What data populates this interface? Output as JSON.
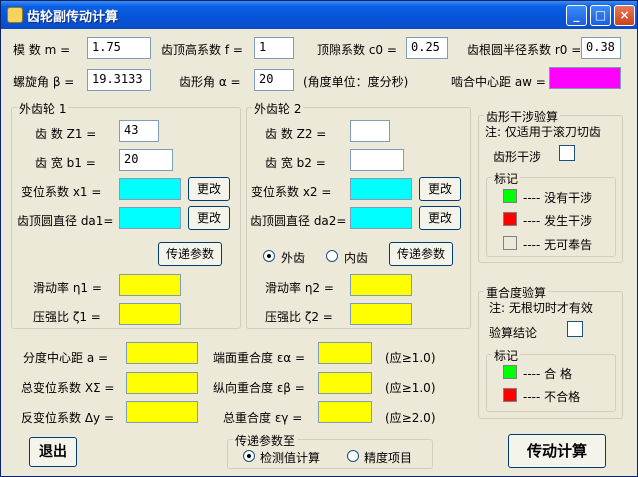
{
  "window": {
    "title": "齿轮副传动计算"
  },
  "params": {
    "module_label": "模  数 m =",
    "module_value": "1.75",
    "addendum_coef_label": "齿顶高系数 f =",
    "addendum_coef_value": "1",
    "clearance_coef_label": "顶隙系数 c0 =",
    "clearance_coef_value": "0.25",
    "root_radius_coef_label": "齿根圆半径系数 r0 =",
    "root_radius_coef_value": "0.38",
    "helix_label": "螺旋角 β =",
    "helix_value": "19.3133",
    "profile_angle_label": "齿形角 α =",
    "profile_angle_value": "20",
    "angle_unit_note": "(角度单位：度分秒)",
    "center_distance_label": "啮合中心距 aw ="
  },
  "gear1": {
    "legend": "外齿轮 1",
    "teeth_label": "齿  数 Z1 =",
    "teeth_value": "43",
    "width_label": "齿  宽 b1 =",
    "width_value": "20",
    "shift_label": "变位系数  x1 =",
    "tip_dia_label": "齿顶圆直径 da1=",
    "change_label": "更改",
    "pass_label": "传递参数",
    "slide_label": "滑动率 η1 =",
    "pressure_label": "压强比 ζ1 ="
  },
  "gear2": {
    "legend": "外齿轮 2",
    "teeth_label": "齿  数  Z2 =",
    "width_label": "齿  宽  b2 =",
    "shift_label": "变位系数  x2 =",
    "tip_dia_label": "齿顶圆直径 da2=",
    "change_label": "更改",
    "external_label": "外齿",
    "internal_label": "内齿",
    "pass_label": "传递参数",
    "slide_label": "滑动率 η2 =",
    "pressure_label": "压强比 ζ2 ="
  },
  "interference": {
    "legend": "齿形干涉验算",
    "note": "注: 仅适用于滚刀切齿",
    "check_label": "齿形干涉",
    "mark_legend": "标记",
    "no_interference": "---- 没有干涉",
    "interference": "---- 发生干涉",
    "no_info": "---- 无可奉告",
    "colors": {
      "ok": "#00ff00",
      "bad": "#ff0000",
      "none": "#ece9d8"
    }
  },
  "overlap": {
    "legend": "重合度验算",
    "note": "注: 无根切时才有效",
    "conclusion_label": "验算结论",
    "mark_legend": "标记",
    "pass": "----  合  格",
    "fail": "---- 不合格"
  },
  "results": {
    "ref_center_label": "分度中心距   a =",
    "total_shift_label": "总变位系数 XΣ =",
    "inverse_shift_label": "反变位系数 Δy =",
    "face_ratio_label": "端面重合度 εα =",
    "face_ratio_req": "(应≥1.0)",
    "axial_ratio_label": "纵向重合度 εβ =",
    "axial_ratio_req": "(应≥1.0)",
    "total_ratio_label": "总重合度 εγ =",
    "total_ratio_req": "(应≥2.0)"
  },
  "transfer": {
    "legend": "传递参数至",
    "option1": "检测值计算",
    "option2": "精度项目"
  },
  "buttons": {
    "exit": "退出",
    "calculate": "传动计算"
  }
}
